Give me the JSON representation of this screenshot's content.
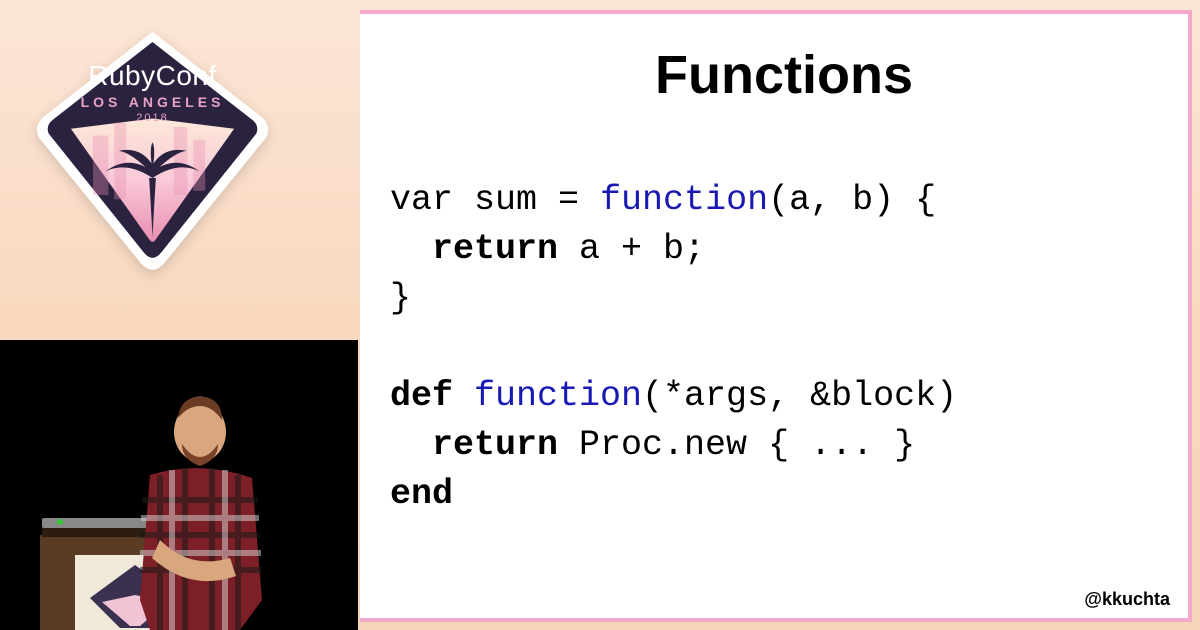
{
  "badge": {
    "title": "RubyConf",
    "subtitle": "LOS ANGELES",
    "year": "2018"
  },
  "slide": {
    "title": "Functions",
    "code": {
      "l1_a": "var sum = ",
      "l1_fn": "function",
      "l1_b": "(a, b) {",
      "l2_ret": "  return",
      "l2_b": " a + b;",
      "l3": "}",
      "l4_def": "def",
      "l4_fn": " function",
      "l4_b": "(*args, &block)",
      "l5_ret": "  return",
      "l5_b": " Proc.new { ... }",
      "l6_end": "end"
    },
    "handle": "@kkuchta"
  }
}
